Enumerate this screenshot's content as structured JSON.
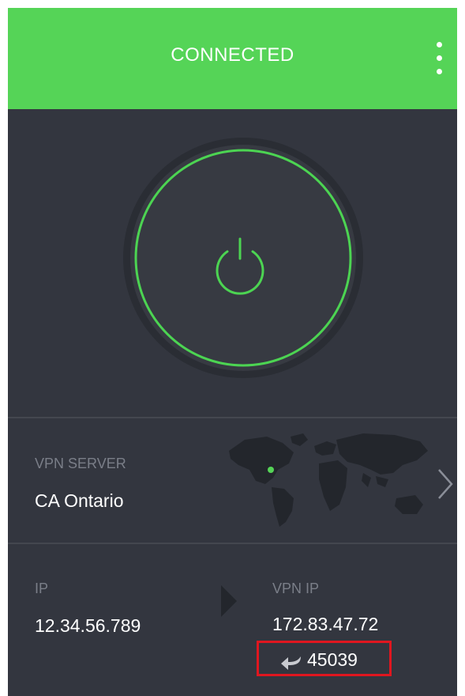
{
  "header": {
    "status": "CONNECTED",
    "menu_icon": "kebab-menu-icon"
  },
  "power": {
    "icon": "power-icon",
    "state": "connected"
  },
  "server": {
    "label": "VPN SERVER",
    "name": "CA Ontario",
    "map_icon": "world-map",
    "chevron_icon": "chevron-right-icon"
  },
  "ip": {
    "local_label": "IP",
    "local_value": "12.34.56.789",
    "vpn_label": "VPN IP",
    "vpn_value": "172.83.47.72",
    "port_icon": "forwarded-port-icon",
    "port": "45039"
  },
  "colors": {
    "accent": "#55d457",
    "ring": "#4cd452",
    "background": "#33363f",
    "highlight": "#e0161f"
  }
}
